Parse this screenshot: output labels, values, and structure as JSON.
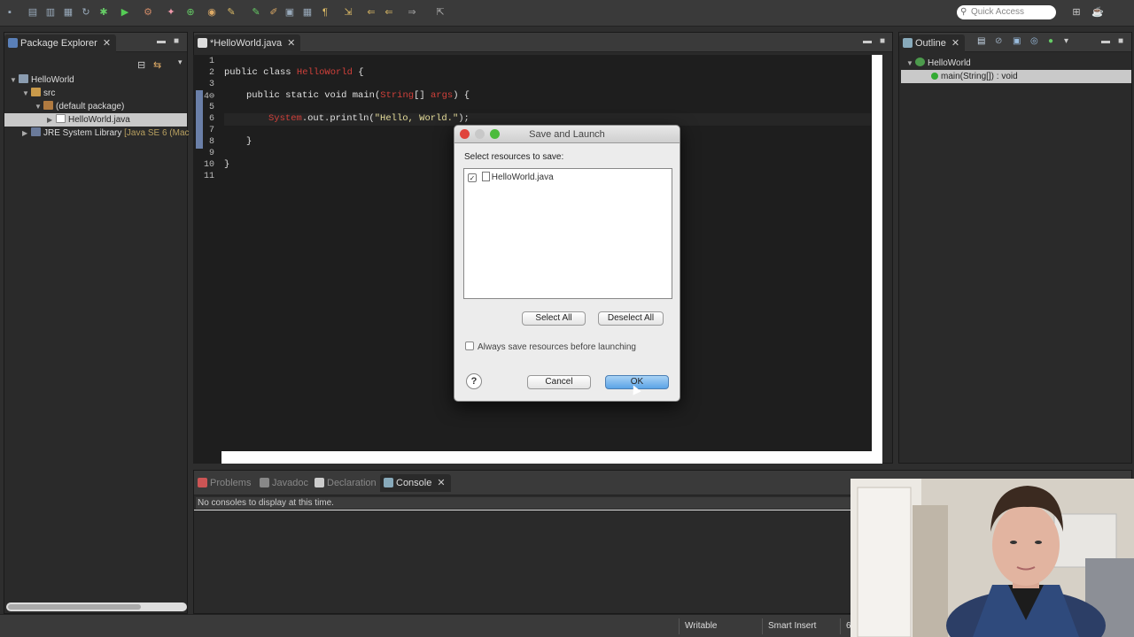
{
  "toolbar": {
    "quick_access_placeholder": "Quick Access"
  },
  "package_explorer": {
    "tab_label": "Package Explorer",
    "tree": [
      {
        "label": "HelloWorld"
      },
      {
        "label": "src"
      },
      {
        "label": "(default package)"
      },
      {
        "label": "HelloWorld.java"
      },
      {
        "label": "JRE System Library",
        "suffix": "[Java SE 6 (Mac"
      }
    ]
  },
  "editor": {
    "tab_label": "*HelloWorld.java",
    "line_numbers": [
      "1",
      "2",
      "3",
      "4⊖",
      "5",
      "6",
      "7",
      "8",
      "9",
      "10",
      "11"
    ],
    "code": {
      "line2_kw": "public class ",
      "line2_name": "HelloWorld",
      "line2_end": " {",
      "line4_kw": "public static void ",
      "line4_main": "main",
      "line4_paren": "(",
      "line4_string": "String",
      "line4_arr": "[] ",
      "line4_args": "args",
      "line4_end": ") {",
      "line6_sys": "System",
      "line6_mid": ".out.println(",
      "line6_str": "\"Hello, World.\"",
      "line6_end": ");",
      "line8": "}",
      "line10": "}"
    }
  },
  "outline": {
    "tab_label": "Outline",
    "items": [
      {
        "label": "HelloWorld"
      },
      {
        "label": "main(String[]) : void"
      }
    ]
  },
  "bottom_panel": {
    "tabs": [
      "Problems",
      "Javadoc",
      "Declaration",
      "Console"
    ],
    "console_message": "No consoles to display at this time."
  },
  "dialog": {
    "title": "Save and Launch",
    "prompt": "Select resources to save:",
    "resources": [
      {
        "label": "HelloWorld.java",
        "checked": true
      }
    ],
    "select_all": "Select All",
    "deselect_all": "Deselect All",
    "always_save_label": "Always save resources before launching",
    "always_save_checked": false,
    "help": "?",
    "cancel": "Cancel",
    "ok": "OK"
  },
  "status_bar": {
    "writable": "Writable",
    "insert_mode": "Smart Insert",
    "position": "6"
  },
  "colors": {
    "editor_bg": "#1e1e1e",
    "keyword_red": "#d0403a",
    "string_yellow": "#e6dd9a",
    "ok_blue": "#5ba3e6"
  }
}
